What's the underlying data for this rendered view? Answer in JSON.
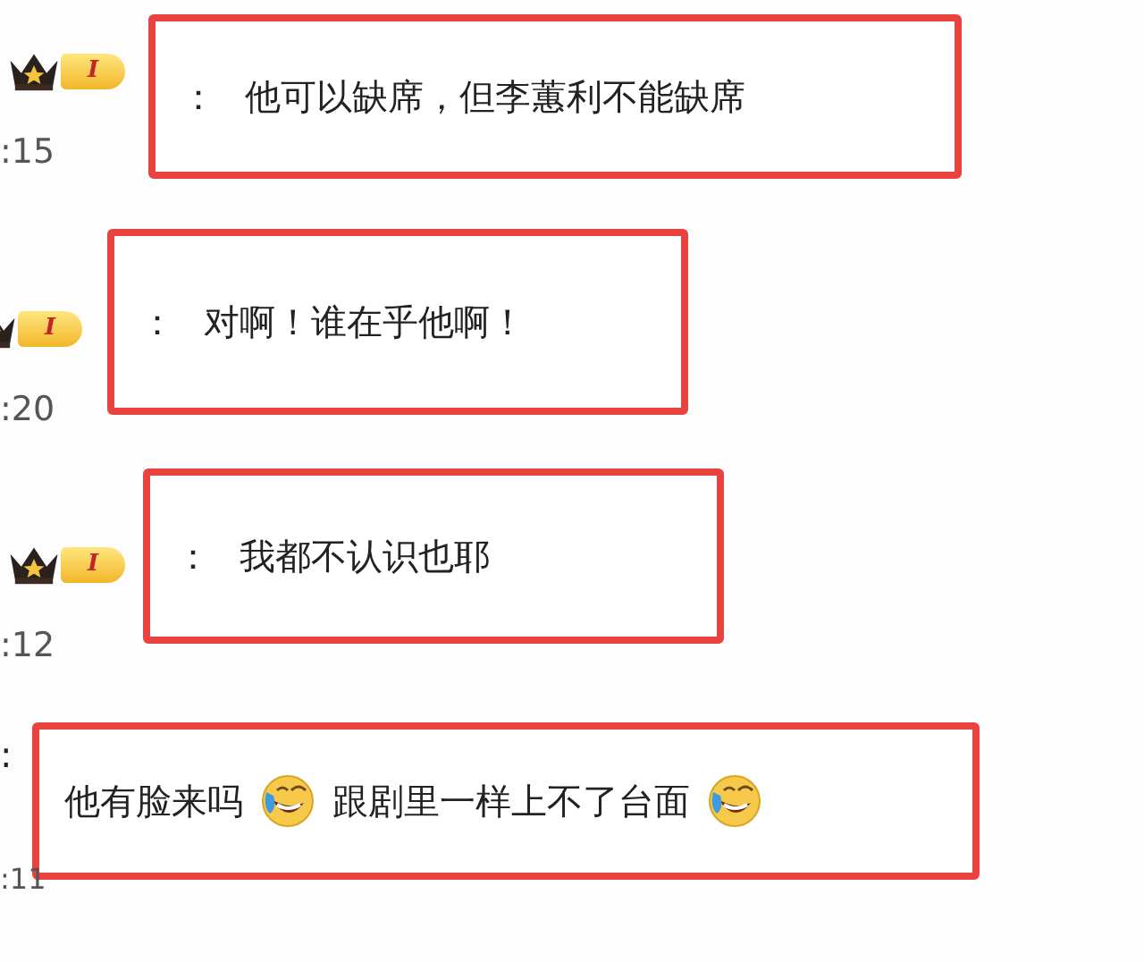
{
  "comments": [
    {
      "kind": "badge",
      "level_badge": "I",
      "time": ":15",
      "separator": "：",
      "parts": [
        {
          "text": "他可以缺席，但李蕙利不能缺席"
        }
      ]
    },
    {
      "kind": "badge",
      "level_badge": "I",
      "time": ":20",
      "separator": "：",
      "parts": [
        {
          "text": "对啊！谁在乎他啊！"
        }
      ]
    },
    {
      "kind": "badge",
      "level_badge": "I",
      "time": ":12",
      "separator": "：",
      "parts": [
        {
          "text": "我都不认识也耶"
        }
      ]
    },
    {
      "kind": "plain",
      "time": ":11",
      "separator": ":",
      "parts": [
        {
          "text": "他有脸来吗"
        },
        {
          "kind": "emoji"
        },
        {
          "text": "跟剧里一样上不了台面"
        },
        {
          "kind": "emoji"
        }
      ]
    }
  ]
}
